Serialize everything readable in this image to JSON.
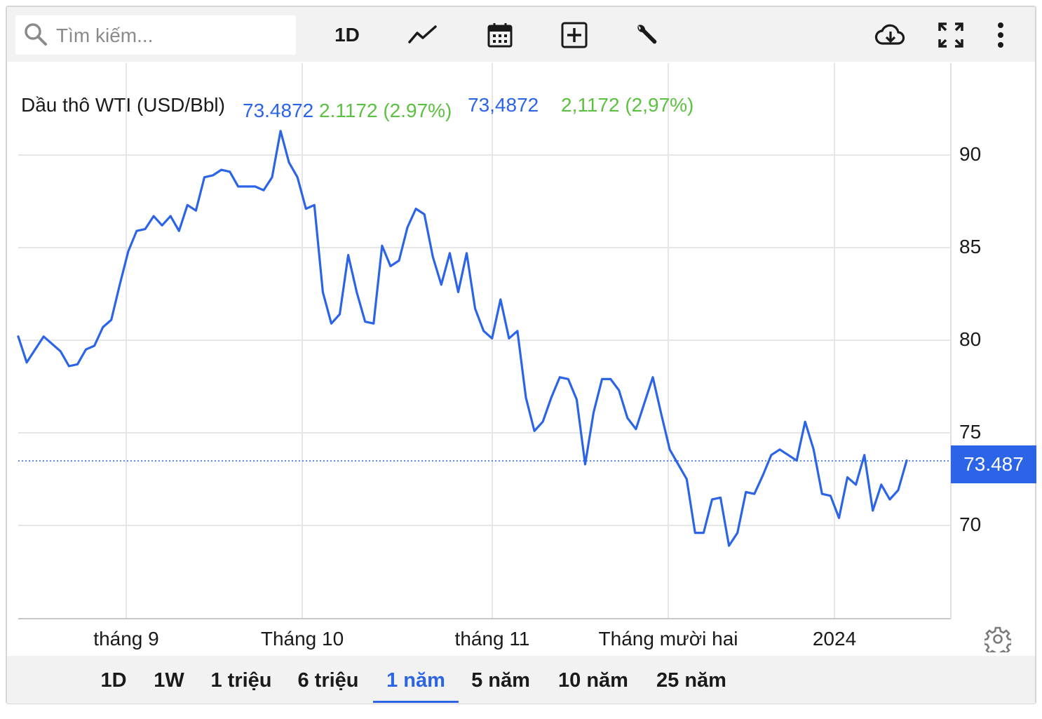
{
  "toolbar": {
    "search_placeholder": "Tìm kiếm...",
    "interval_label": "1D",
    "icons": [
      "search-icon",
      "line-chart-icon",
      "calendar-icon",
      "add-indicator-icon",
      "wrench-icon",
      "cloud-download-icon",
      "fullscreen-icon",
      "more-vert-icon"
    ]
  },
  "legend": {
    "name": "Dầu thô WTI (USD/Bbl)",
    "value_a": "73.4872",
    "change_a": "2.1172 (2.97%)",
    "value_b": "73,4872",
    "change_b": "2,1172 (2,97%)"
  },
  "colors": {
    "line": "#2c64e8",
    "change_positive": "#5cc040",
    "price_tag_bg": "#2c64e8",
    "grid": "#e6e6e6"
  },
  "price_tag": "73.487",
  "range_tabs": [
    {
      "label": "1D",
      "active": false
    },
    {
      "label": "1W",
      "active": false
    },
    {
      "label": "1 triệu",
      "active": false
    },
    {
      "label": "6 triệu",
      "active": false
    },
    {
      "label": "1 năm",
      "active": true
    },
    {
      "label": "5 năm",
      "active": false
    },
    {
      "label": "10 năm",
      "active": false
    },
    {
      "label": "25 năm",
      "active": false
    }
  ],
  "chart_data": {
    "type": "line",
    "title": "Dầu thô WTI (USD/Bbl)",
    "xlabel": "",
    "ylabel": "",
    "ylim": [
      64,
      95
    ],
    "y_ticks": [
      70,
      75,
      80,
      85,
      90
    ],
    "x_tick_labels": [
      "tháng 9",
      "Tháng 10",
      "tháng 11",
      "Tháng mười hai",
      "2024"
    ],
    "current_value": 73.487,
    "grid": true,
    "series": [
      {
        "values": [
          80.2,
          78.8,
          79.5,
          80.2,
          79.8,
          79.4,
          78.6,
          78.7,
          79.5,
          79.7,
          80.7,
          81.1,
          83.0,
          84.8,
          85.9,
          86.0,
          86.7,
          86.2,
          86.7,
          85.9,
          87.3,
          87.0,
          88.8,
          88.9,
          89.2,
          89.1,
          88.3,
          88.3,
          88.3,
          88.1,
          88.8,
          91.3,
          89.6,
          88.8,
          87.1,
          87.3,
          82.6,
          80.9,
          81.4,
          84.6,
          82.6,
          81.0,
          80.9,
          85.1,
          84.0,
          84.3,
          86.1,
          87.1,
          86.8,
          84.5,
          83.0,
          84.7,
          82.6,
          84.7,
          81.7,
          80.5,
          80.1,
          82.2,
          80.1,
          80.5,
          76.9,
          75.1,
          75.6,
          76.9,
          78.0,
          77.9,
          76.8,
          73.3,
          76.1,
          77.9,
          77.9,
          77.3,
          75.8,
          75.2,
          76.6,
          78.0,
          76.0,
          74.1,
          73.3,
          72.5,
          69.6,
          69.6,
          71.4,
          71.5,
          68.9,
          69.6,
          71.8,
          71.7,
          72.7,
          73.8,
          74.1,
          73.8,
          73.5,
          75.6,
          74.1,
          71.7,
          71.6,
          70.4,
          72.6,
          72.2,
          73.8,
          70.8,
          72.2,
          71.4,
          71.9,
          73.5
        ]
      }
    ]
  }
}
